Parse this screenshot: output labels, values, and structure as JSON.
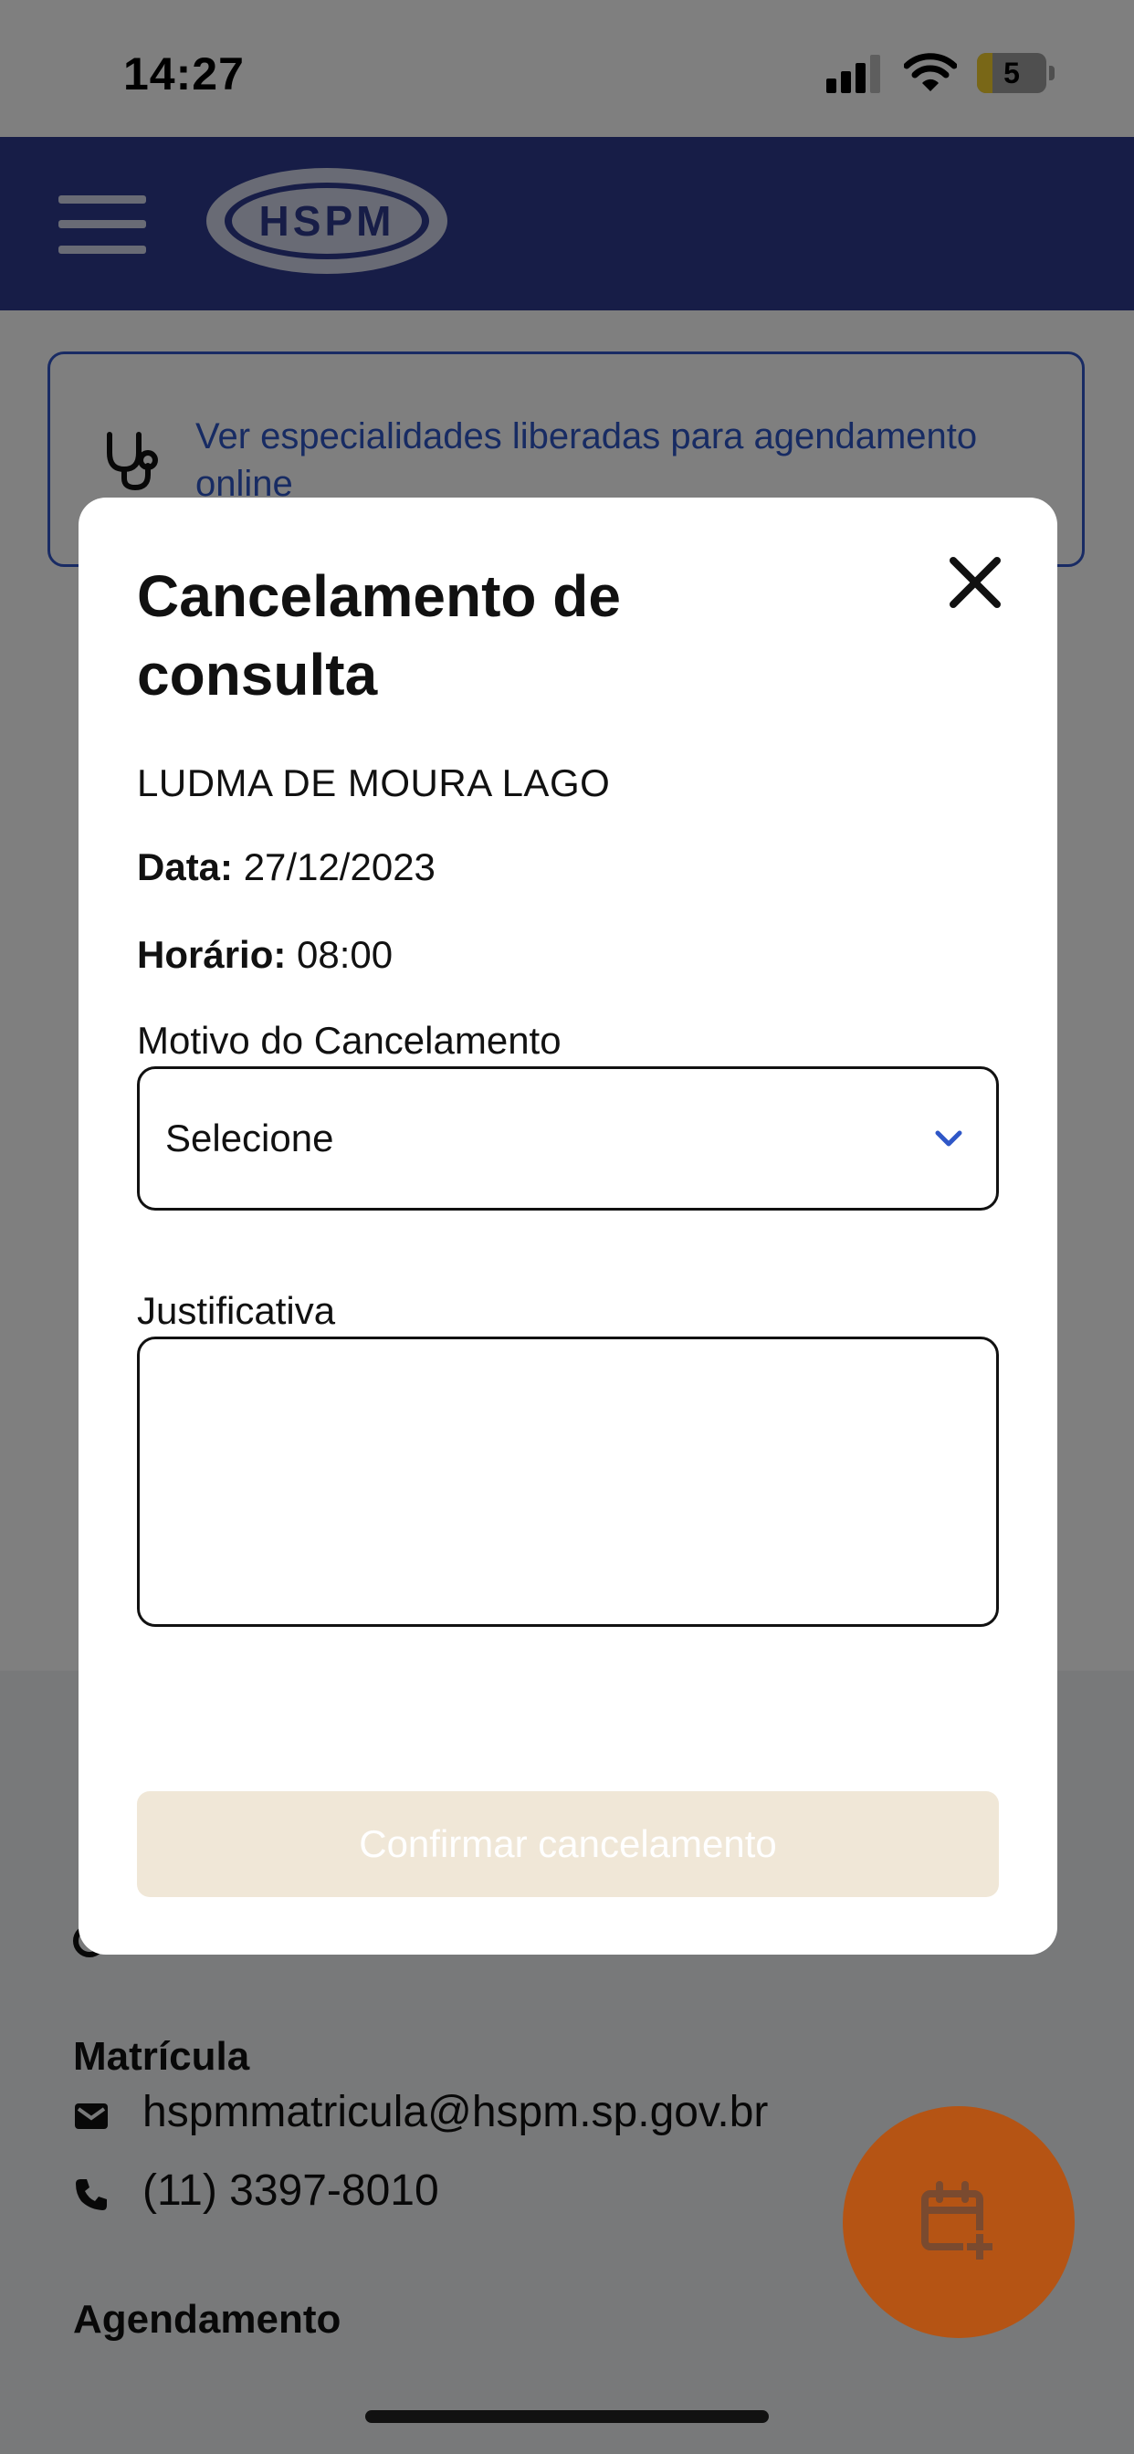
{
  "status_bar": {
    "time": "14:27",
    "battery_level": "5",
    "battery_fraction": 0.22
  },
  "header": {
    "logo_text": "HSPM"
  },
  "info_card": {
    "text": "Ver especialidades liberadas para agendamento online"
  },
  "contacts": {
    "matricula": {
      "title": "Matrícula",
      "email": "hspmmatricula@hspm.sp.gov.br",
      "phone": "(11) 3397-8010"
    },
    "agendamento": {
      "title": "Agendamento"
    }
  },
  "modal": {
    "title": "Cancelamento de consulta",
    "patient_name": "LUDMA DE MOURA LAGO",
    "date_label": "Data:",
    "date_value": "27/12/2023",
    "time_label": "Horário:",
    "time_value": "08:00",
    "reason_label": "Motivo do Cancelamento",
    "reason_value": "Selecione",
    "justification_label": "Justificativa",
    "justification_value": "",
    "confirm_label": "Confirmar cancelamento"
  },
  "colors": {
    "header_bg": "#2f3a8e",
    "link_blue": "#2f57c7",
    "fab_orange": "#b55414",
    "confirm_disabled": "#f0e7d7"
  }
}
